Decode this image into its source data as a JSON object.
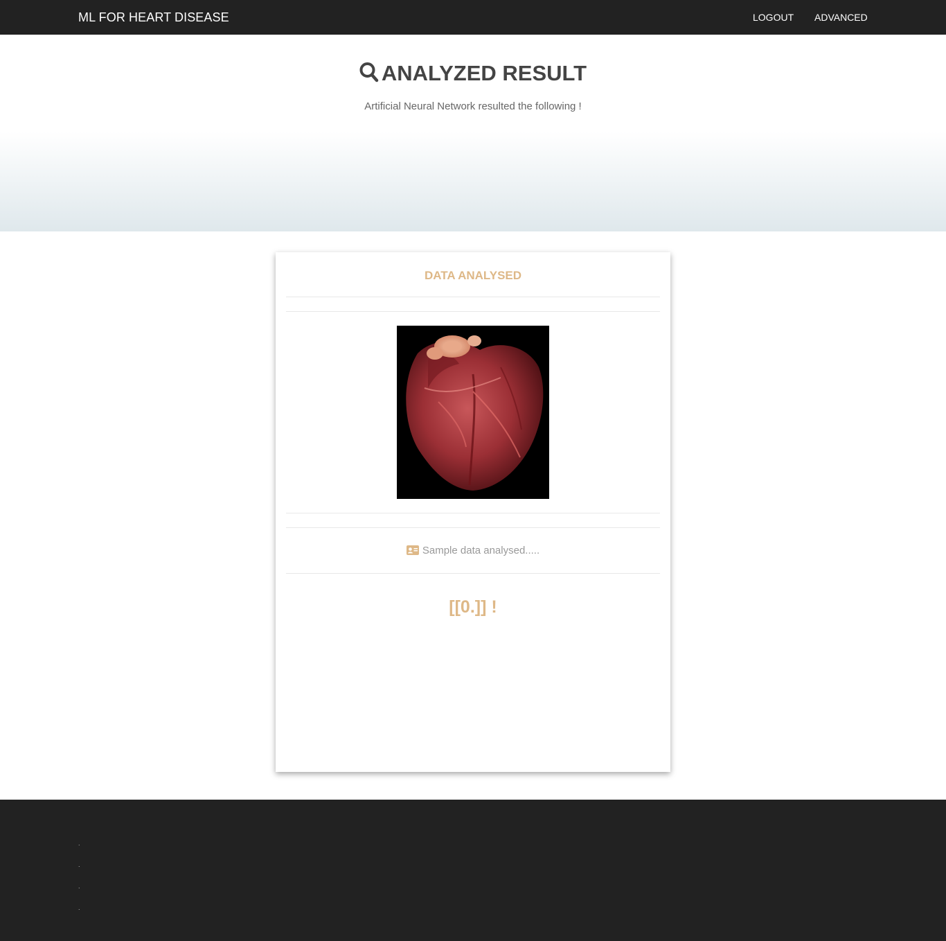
{
  "navbar": {
    "brand": "ML FOR HEART DISEASE",
    "links": [
      {
        "label": "LOGOUT"
      },
      {
        "label": "ADVANCED"
      }
    ]
  },
  "hero": {
    "icon": "search-icon",
    "title": "ANALYZED RESULT",
    "subtitle": "Artificial Neural Network resulted the following !"
  },
  "card": {
    "title": "DATA ANALYSED",
    "image": "heart-image",
    "sample_icon": "id-card-icon",
    "sample_text": "Sample data analysed.....",
    "result": "[[0.]] !"
  },
  "footer": {
    "items": [
      ".",
      ".",
      ".",
      "."
    ]
  },
  "colors": {
    "navbar": "#222222",
    "accent": "#deb887",
    "title": "#444444"
  }
}
